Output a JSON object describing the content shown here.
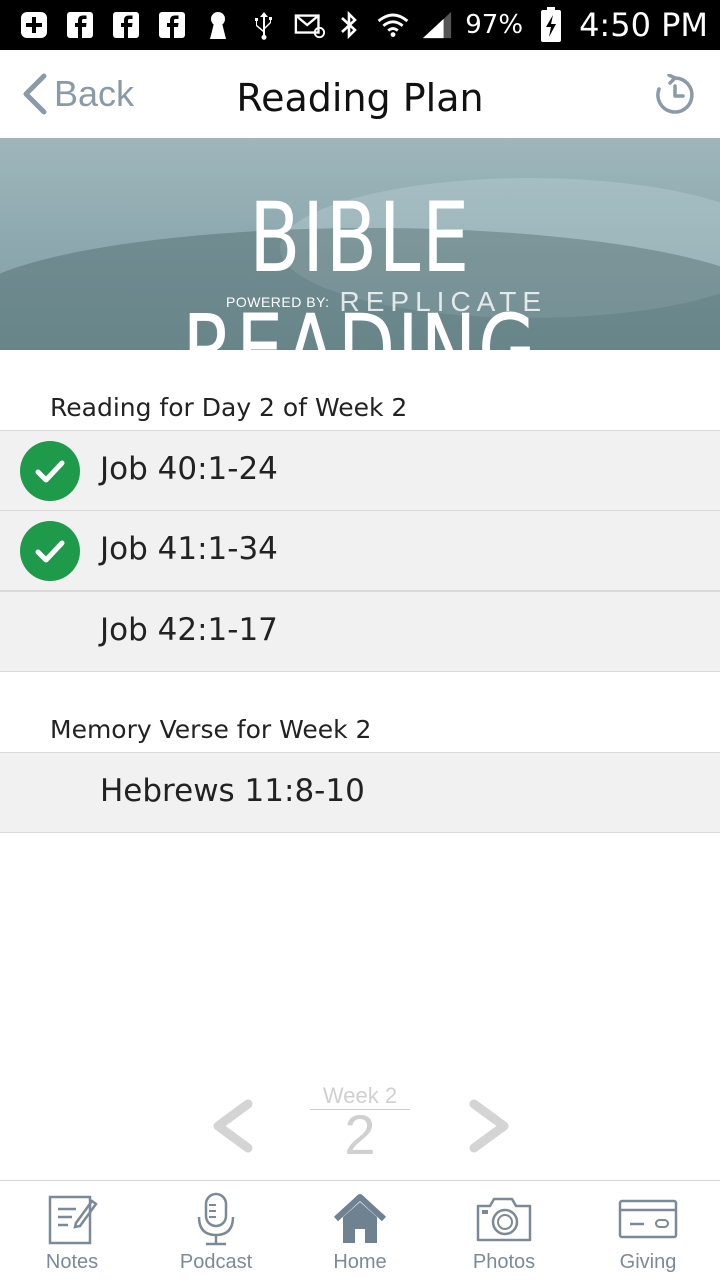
{
  "status_bar": {
    "battery_percent": "97%",
    "time": "4:50 PM",
    "left_icons": [
      "add-box-icon",
      "facebook-icon",
      "facebook-icon",
      "facebook-icon",
      "keyhole-icon",
      "usb-icon",
      "email-icon"
    ],
    "right_icons": [
      "bluetooth-icon",
      "wifi-icon",
      "signal-icon",
      "battery-charging-icon"
    ]
  },
  "nav": {
    "back_label": "Back",
    "title": "Reading Plan",
    "right_icon": "history-icon"
  },
  "banner": {
    "title": "BIBLE READING",
    "powered_label": "POWERED BY:",
    "brand": "REPLICATE"
  },
  "reading": {
    "header": "Reading for Day 2 of Week 2",
    "items": [
      {
        "label": "Job 40:1-24",
        "completed": true
      },
      {
        "label": "Job 41:1-34",
        "completed": true
      },
      {
        "label": "Job 42:1-17",
        "completed": false
      }
    ]
  },
  "memory": {
    "header": "Memory Verse for Week 2",
    "items": [
      {
        "label": "Hebrews 11:8-10"
      }
    ]
  },
  "pager": {
    "week_label": "Week 2",
    "week_number": "2"
  },
  "tabs": [
    {
      "label": "Notes",
      "icon": "notes-icon"
    },
    {
      "label": "Podcast",
      "icon": "microphone-icon"
    },
    {
      "label": "Home",
      "icon": "home-icon"
    },
    {
      "label": "Photos",
      "icon": "camera-icon"
    },
    {
      "label": "Giving",
      "icon": "credit-card-icon"
    }
  ],
  "colors": {
    "check_green": "#1e9a4a",
    "nav_accent": "#8a9aa6",
    "banner_teal": "#8eaab0",
    "row_bg": "#f1f1f1"
  }
}
